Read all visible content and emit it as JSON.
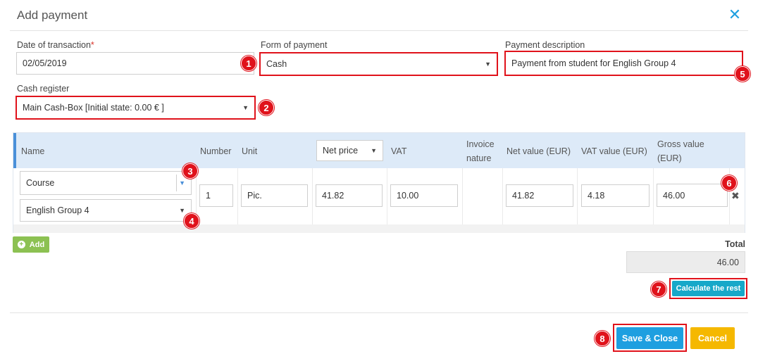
{
  "dialog": {
    "title": "Add payment"
  },
  "icons": {
    "close": "close-icon",
    "caret": "caret-down-icon",
    "plus": "plus-circle-icon",
    "remove": "remove-row-icon"
  },
  "colors": {
    "accent": "#1e9fe0",
    "annotation": "#e0121b",
    "add": "#8cc152",
    "calc": "#17a8c9",
    "save": "#1e9fe0",
    "cancel": "#f5b800"
  },
  "form": {
    "date_label": "Date of transaction",
    "date_required": "*",
    "date_value": "02/05/2019",
    "form_label": "Form of payment",
    "form_value": "Cash",
    "desc_label": "Payment description",
    "desc_value": "Payment from student for English Group 4",
    "cash_label": "Cash register",
    "cash_value": "Main Cash-Box [Initial state: 0.00 € ]"
  },
  "table": {
    "headers": {
      "name": "Name",
      "number": "Number",
      "unit": "Unit",
      "price_type": "Net price",
      "vat": "VAT",
      "invoice_1": "Invoice",
      "invoice_2": "nature",
      "net_value": "Net value (EUR)",
      "vat_value": "VAT value (EUR)",
      "gross_1": "Gross value",
      "gross_2": "(EUR)"
    },
    "row": {
      "name_type": "Course",
      "name_item": "English Group 4",
      "number": "1",
      "unit": "Pic.",
      "net_price": "41.82",
      "vat": "10.00",
      "net_value": "41.82",
      "vat_value": "4.18",
      "gross_value": "46.00"
    }
  },
  "add_label": "Add",
  "total": {
    "label": "Total",
    "value": "46.00"
  },
  "buttons": {
    "calculate": "Calculate the rest",
    "save": "Save & Close",
    "cancel": "Cancel"
  },
  "annotations": {
    "b1": "1",
    "b2": "2",
    "b3": "3",
    "b4": "4",
    "b5": "5",
    "b6": "6",
    "b7": "7",
    "b8": "8"
  }
}
